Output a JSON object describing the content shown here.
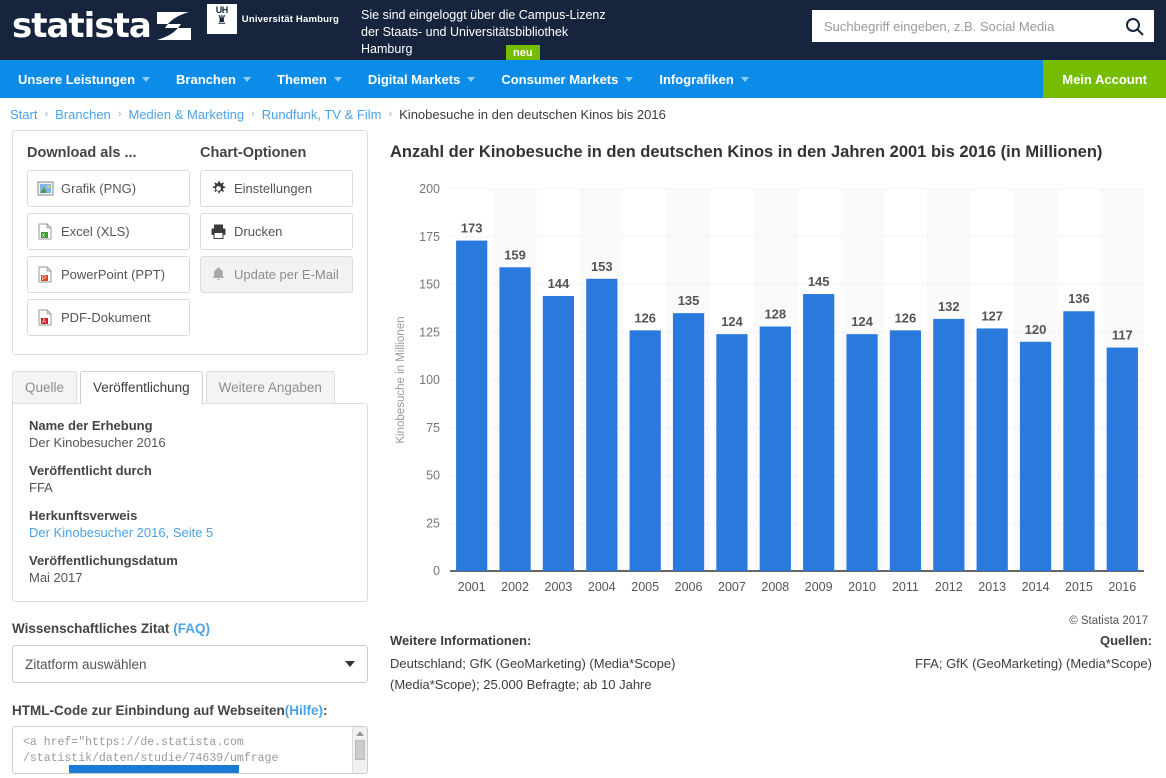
{
  "header": {
    "logo_text": "statista",
    "logo_mark_icon": "statista-swoosh-icon",
    "university": {
      "abbr": "UH",
      "glyph": "♜",
      "label": "Universität Hamburg"
    },
    "campus_message_line1": "Sie sind eingeloggt über die Campus-Lizenz",
    "campus_message_line2": "der Staats- und Universitätsbibliothek",
    "campus_message_line3": "Hamburg",
    "new_badge": "neu",
    "search_placeholder": "Suchbegriff eingeben, z.B. Social Media",
    "search_value": "",
    "search_icon": "search-icon"
  },
  "nav": {
    "items": [
      {
        "label": "Unsere Leistungen",
        "has_caret": true
      },
      {
        "label": "Branchen",
        "has_caret": true
      },
      {
        "label": "Themen",
        "has_caret": true
      },
      {
        "label": "Digital Markets",
        "has_caret": true
      },
      {
        "label": "Consumer Markets",
        "has_caret": true
      },
      {
        "label": "Infografiken",
        "has_caret": true
      }
    ],
    "account_label": "Mein Account",
    "bg_color": "#0c8ce9",
    "account_color": "#76bc00"
  },
  "breadcrumb": {
    "items": [
      {
        "label": "Start",
        "link": true
      },
      {
        "label": "Branchen",
        "link": true
      },
      {
        "label": "Medien & Marketing",
        "link": true
      },
      {
        "label": "Rundfunk, TV & Film",
        "link": true
      },
      {
        "label": "Kinobesuche in den deutschen Kinos bis 2016",
        "link": false
      }
    ],
    "separator": "›"
  },
  "sidebar": {
    "download_title": "Download als ...",
    "chart_options_title": "Chart-Optionen",
    "download_buttons": [
      {
        "label": "Grafik (PNG)",
        "icon": "image-file-icon"
      },
      {
        "label": "Excel (XLS)",
        "icon": "excel-file-icon"
      },
      {
        "label": "PowerPoint (PPT)",
        "icon": "powerpoint-file-icon"
      },
      {
        "label": "PDF-Dokument",
        "icon": "pdf-file-icon"
      }
    ],
    "option_buttons": [
      {
        "label": "Einstellungen",
        "icon": "gear-icon",
        "disabled": false
      },
      {
        "label": "Drucken",
        "icon": "printer-icon",
        "disabled": false
      },
      {
        "label": "Update per E-Mail",
        "icon": "bell-icon",
        "disabled": true
      }
    ],
    "tabs": [
      {
        "label": "Quelle",
        "active": false
      },
      {
        "label": "Veröffentlichung",
        "active": true
      },
      {
        "label": "Weitere Angaben",
        "active": false
      }
    ],
    "meta": [
      {
        "label": "Name der Erhebung",
        "value": "Der Kinobesucher 2016",
        "link": false
      },
      {
        "label": "Veröffentlicht durch",
        "value": "FFA",
        "link": false
      },
      {
        "label": "Herkunftsverweis",
        "value": "Der Kinobesucher 2016, Seite 5",
        "link": true
      },
      {
        "label": "Veröffentlichungsdatum",
        "value": "Mai 2017",
        "link": false
      }
    ],
    "citation": {
      "title": "Wissenschaftliches Zitat",
      "faq": "(FAQ)",
      "select_value": "Zitatform auswählen"
    },
    "embed": {
      "title": "HTML-Code zur Einbindung auf Webseiten",
      "help": "(Hilfe)",
      "code_line1": "<a href=\"https://de.statista.com",
      "code_line2": "/statistik/daten/studie/74639/umfrage"
    }
  },
  "chart_data": {
    "type": "bar",
    "title": "Anzahl der Kinobesuche in den deutschen Kinos in den Jahren 2001 bis 2016 (in Millionen)",
    "xlabel": "",
    "ylabel": "Kinobesuche in Millionen",
    "categories": [
      "2001",
      "2002",
      "2003",
      "2004",
      "2005",
      "2006",
      "2007",
      "2008",
      "2009",
      "2010",
      "2011",
      "2012",
      "2013",
      "2014",
      "2015",
      "2016"
    ],
    "values": [
      173,
      159,
      144,
      153,
      126,
      135,
      124,
      128,
      145,
      124,
      126,
      132,
      127,
      120,
      136,
      117
    ],
    "ylim": [
      0,
      200
    ],
    "yticks": [
      0,
      25,
      50,
      75,
      100,
      125,
      150,
      175,
      200
    ],
    "bar_color": "#2a7ade",
    "grid": true,
    "legend": false,
    "show_data_labels": true
  },
  "footer": {
    "copyright": "© Statista 2017",
    "more_info_head": "Weitere Informationen:",
    "more_info_line1": "Deutschland; GfK (GeoMarketing) (Media*Scope)",
    "more_info_line2": "(Media*Scope); 25.000 Befragte; ab 10 Jahre",
    "sources_head": "Quellen:",
    "sources_line1": "FFA; GfK (GeoMarketing) (Media*Scope)"
  }
}
